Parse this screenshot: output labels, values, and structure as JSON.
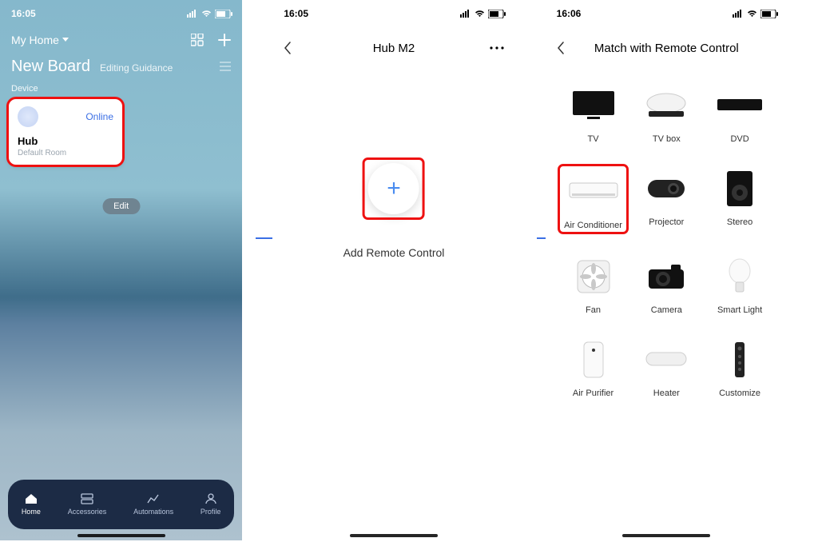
{
  "screen1": {
    "time": "16:05",
    "home_label": "My Home",
    "board_title": "New Board",
    "editing_guidance": "Editing Guidance",
    "device_section": "Device",
    "device": {
      "status": "Online",
      "name": "Hub",
      "room": "Default Room"
    },
    "edit_button": "Edit",
    "tabs": {
      "home": "Home",
      "accessories": "Accessories",
      "automations": "Automations",
      "profile": "Profile"
    }
  },
  "screen2": {
    "time": "16:05",
    "title": "Hub M2",
    "add_label": "Add Remote Control"
  },
  "screen3": {
    "time": "16:06",
    "title": "Match with Remote Control",
    "items": {
      "tv": "TV",
      "tvbox": "TV box",
      "dvd": "DVD",
      "ac": "Air Conditioner",
      "projector": "Projector",
      "stereo": "Stereo",
      "fan": "Fan",
      "camera": "Camera",
      "light": "Smart Light",
      "purifier": "Air Purifier",
      "heater": "Heater",
      "customize": "Customize"
    }
  }
}
